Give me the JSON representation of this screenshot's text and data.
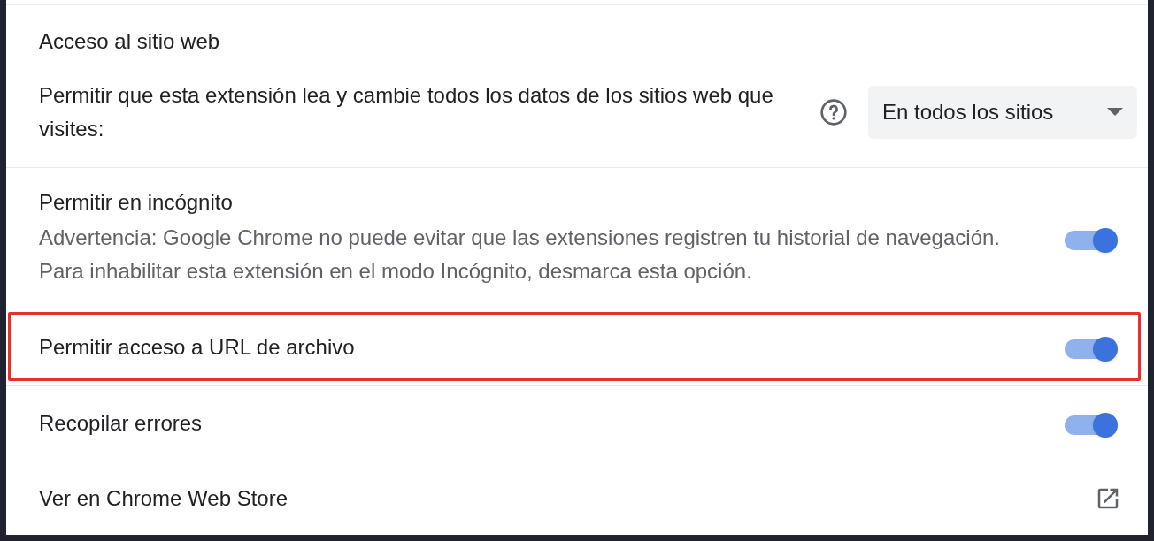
{
  "site_access": {
    "title": "Acceso al sitio web",
    "description": "Permitir que esta extensión lea y cambie todos los datos de los sitios web que visites:",
    "dropdown": {
      "value": "En todos los sitios"
    }
  },
  "settings": [
    {
      "kind": "toggle",
      "label": "Permitir en incógnito",
      "description": [
        "Advertencia: Google Chrome no puede evitar que las extensiones registren tu historial de navegación.",
        "Para inhabilitar esta extensión en el modo Incógnito, desmarca esta opción."
      ],
      "on": true,
      "highlighted": false
    },
    {
      "kind": "toggle",
      "label": "Permitir acceso a URL de archivo",
      "on": true,
      "highlighted": true
    },
    {
      "kind": "toggle",
      "label": "Recopilar errores",
      "on": true,
      "highlighted": false
    },
    {
      "kind": "link",
      "label": "Ver en Chrome Web Store"
    }
  ]
}
